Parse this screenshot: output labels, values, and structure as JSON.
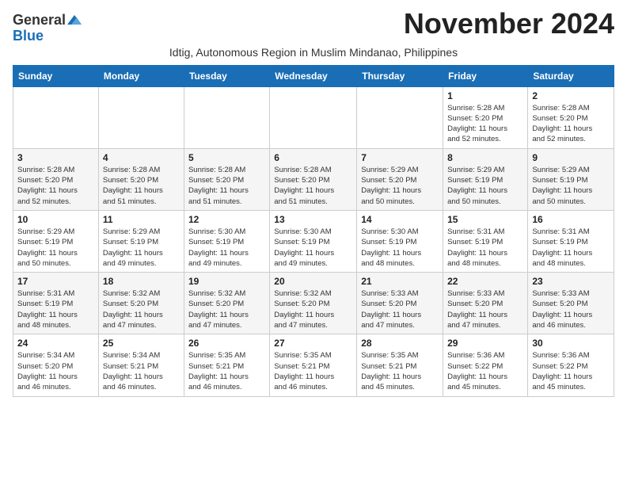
{
  "header": {
    "logo_general": "General",
    "logo_blue": "Blue",
    "month_title": "November 2024",
    "subtitle": "Idtig, Autonomous Region in Muslim Mindanao, Philippines"
  },
  "calendar": {
    "days_of_week": [
      "Sunday",
      "Monday",
      "Tuesday",
      "Wednesday",
      "Thursday",
      "Friday",
      "Saturday"
    ],
    "weeks": [
      [
        {
          "day": "",
          "info": ""
        },
        {
          "day": "",
          "info": ""
        },
        {
          "day": "",
          "info": ""
        },
        {
          "day": "",
          "info": ""
        },
        {
          "day": "",
          "info": ""
        },
        {
          "day": "1",
          "info": "Sunrise: 5:28 AM\nSunset: 5:20 PM\nDaylight: 11 hours\nand 52 minutes."
        },
        {
          "day": "2",
          "info": "Sunrise: 5:28 AM\nSunset: 5:20 PM\nDaylight: 11 hours\nand 52 minutes."
        }
      ],
      [
        {
          "day": "3",
          "info": "Sunrise: 5:28 AM\nSunset: 5:20 PM\nDaylight: 11 hours\nand 52 minutes."
        },
        {
          "day": "4",
          "info": "Sunrise: 5:28 AM\nSunset: 5:20 PM\nDaylight: 11 hours\nand 51 minutes."
        },
        {
          "day": "5",
          "info": "Sunrise: 5:28 AM\nSunset: 5:20 PM\nDaylight: 11 hours\nand 51 minutes."
        },
        {
          "day": "6",
          "info": "Sunrise: 5:28 AM\nSunset: 5:20 PM\nDaylight: 11 hours\nand 51 minutes."
        },
        {
          "day": "7",
          "info": "Sunrise: 5:29 AM\nSunset: 5:20 PM\nDaylight: 11 hours\nand 50 minutes."
        },
        {
          "day": "8",
          "info": "Sunrise: 5:29 AM\nSunset: 5:19 PM\nDaylight: 11 hours\nand 50 minutes."
        },
        {
          "day": "9",
          "info": "Sunrise: 5:29 AM\nSunset: 5:19 PM\nDaylight: 11 hours\nand 50 minutes."
        }
      ],
      [
        {
          "day": "10",
          "info": "Sunrise: 5:29 AM\nSunset: 5:19 PM\nDaylight: 11 hours\nand 50 minutes."
        },
        {
          "day": "11",
          "info": "Sunrise: 5:29 AM\nSunset: 5:19 PM\nDaylight: 11 hours\nand 49 minutes."
        },
        {
          "day": "12",
          "info": "Sunrise: 5:30 AM\nSunset: 5:19 PM\nDaylight: 11 hours\nand 49 minutes."
        },
        {
          "day": "13",
          "info": "Sunrise: 5:30 AM\nSunset: 5:19 PM\nDaylight: 11 hours\nand 49 minutes."
        },
        {
          "day": "14",
          "info": "Sunrise: 5:30 AM\nSunset: 5:19 PM\nDaylight: 11 hours\nand 48 minutes."
        },
        {
          "day": "15",
          "info": "Sunrise: 5:31 AM\nSunset: 5:19 PM\nDaylight: 11 hours\nand 48 minutes."
        },
        {
          "day": "16",
          "info": "Sunrise: 5:31 AM\nSunset: 5:19 PM\nDaylight: 11 hours\nand 48 minutes."
        }
      ],
      [
        {
          "day": "17",
          "info": "Sunrise: 5:31 AM\nSunset: 5:19 PM\nDaylight: 11 hours\nand 48 minutes."
        },
        {
          "day": "18",
          "info": "Sunrise: 5:32 AM\nSunset: 5:20 PM\nDaylight: 11 hours\nand 47 minutes."
        },
        {
          "day": "19",
          "info": "Sunrise: 5:32 AM\nSunset: 5:20 PM\nDaylight: 11 hours\nand 47 minutes."
        },
        {
          "day": "20",
          "info": "Sunrise: 5:32 AM\nSunset: 5:20 PM\nDaylight: 11 hours\nand 47 minutes."
        },
        {
          "day": "21",
          "info": "Sunrise: 5:33 AM\nSunset: 5:20 PM\nDaylight: 11 hours\nand 47 minutes."
        },
        {
          "day": "22",
          "info": "Sunrise: 5:33 AM\nSunset: 5:20 PM\nDaylight: 11 hours\nand 47 minutes."
        },
        {
          "day": "23",
          "info": "Sunrise: 5:33 AM\nSunset: 5:20 PM\nDaylight: 11 hours\nand 46 minutes."
        }
      ],
      [
        {
          "day": "24",
          "info": "Sunrise: 5:34 AM\nSunset: 5:20 PM\nDaylight: 11 hours\nand 46 minutes."
        },
        {
          "day": "25",
          "info": "Sunrise: 5:34 AM\nSunset: 5:21 PM\nDaylight: 11 hours\nand 46 minutes."
        },
        {
          "day": "26",
          "info": "Sunrise: 5:35 AM\nSunset: 5:21 PM\nDaylight: 11 hours\nand 46 minutes."
        },
        {
          "day": "27",
          "info": "Sunrise: 5:35 AM\nSunset: 5:21 PM\nDaylight: 11 hours\nand 46 minutes."
        },
        {
          "day": "28",
          "info": "Sunrise: 5:35 AM\nSunset: 5:21 PM\nDaylight: 11 hours\nand 45 minutes."
        },
        {
          "day": "29",
          "info": "Sunrise: 5:36 AM\nSunset: 5:22 PM\nDaylight: 11 hours\nand 45 minutes."
        },
        {
          "day": "30",
          "info": "Sunrise: 5:36 AM\nSunset: 5:22 PM\nDaylight: 11 hours\nand 45 minutes."
        }
      ]
    ]
  }
}
